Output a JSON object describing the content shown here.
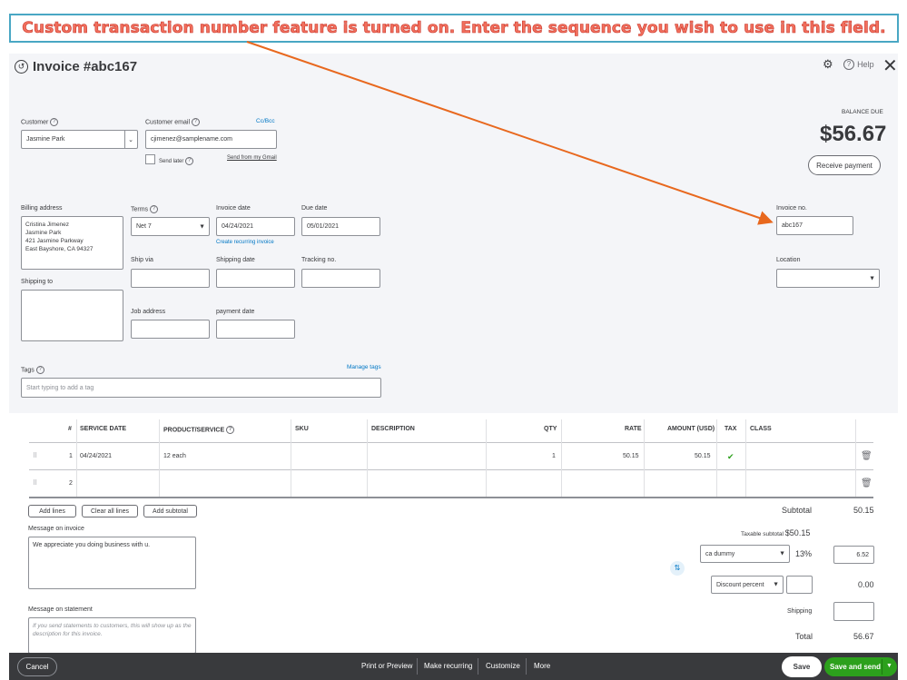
{
  "banner": {
    "text": "Custom transaction number feature is turned on. Enter the sequence you wish to use in this field."
  },
  "header": {
    "title": "Invoice #abc167",
    "help_label": "Help"
  },
  "customer": {
    "label": "Customer",
    "value": "Jasmine Park"
  },
  "customer_email": {
    "label": "Customer email",
    "value": "cjimenez@samplename.com",
    "cc_bcc": "Cc/Bcc",
    "send_later": "Send later",
    "send_gmail": "Send from my Gmail"
  },
  "balance": {
    "label": "BALANCE DUE",
    "amount": "$56.67",
    "receive_payment": "Receive payment"
  },
  "billing": {
    "label": "Billing address",
    "lines": [
      "Cristina Jimenez",
      "Jasmine Park",
      "421 Jasmine Parkway",
      "East Bayshore, CA  94327"
    ]
  },
  "shipping_to": {
    "label": "Shipping to"
  },
  "terms": {
    "label": "Terms",
    "value": "Net 7"
  },
  "invoice_date": {
    "label": "Invoice date",
    "value": "04/24/2021",
    "recurring_link": "Create recurring invoice"
  },
  "due_date": {
    "label": "Due date",
    "value": "05/01/2021"
  },
  "ship_via": {
    "label": "Ship via"
  },
  "shipping_date": {
    "label": "Shipping date"
  },
  "tracking_no": {
    "label": "Tracking no."
  },
  "job_address": {
    "label": "Job address"
  },
  "payment_date": {
    "label": "payment date"
  },
  "invoice_no": {
    "label": "Invoice no.",
    "value": "abc167"
  },
  "location": {
    "label": "Location"
  },
  "tags": {
    "label": "Tags",
    "manage": "Manage tags",
    "placeholder": "Start typing to add a tag"
  },
  "table": {
    "headers": [
      "#",
      "SERVICE DATE",
      "PRODUCT/SERVICE",
      "SKU",
      "DESCRIPTION",
      "QTY",
      "RATE",
      "AMOUNT (USD)",
      "TAX",
      "CLASS"
    ],
    "rows": [
      {
        "num": "1",
        "service_date": "04/24/2021",
        "product": "12 each",
        "qty": "1",
        "rate": "50.15",
        "amount": "50.15",
        "tax": "✔"
      },
      {
        "num": "2",
        "service_date": "",
        "product": "",
        "qty": "",
        "rate": "",
        "amount": "",
        "tax": ""
      }
    ]
  },
  "actions": {
    "add_lines": "Add lines",
    "clear_all": "Clear all lines",
    "add_subtotal": "Add subtotal"
  },
  "message_invoice": {
    "label": "Message on invoice",
    "value": "We appreciate you doing business with u."
  },
  "message_statement": {
    "label": "Message on statement",
    "placeholder": "If you send statements to customers, this will show up as the description for this invoice."
  },
  "totals": {
    "subtotal_label": "Subtotal",
    "subtotal": "50.15",
    "taxable_label": "Taxable subtotal",
    "taxable": "$50.15",
    "tax_name": "ca dummy",
    "tax_pct": "13%",
    "tax_amount": "6.52",
    "discount_type": "Discount percent",
    "discount_amount": "0.00",
    "shipping_label": "Shipping",
    "total_label": "Total",
    "total": "56.67"
  },
  "footer": {
    "cancel": "Cancel",
    "print": "Print or Preview",
    "recurring": "Make recurring",
    "customize": "Customize",
    "more": "More",
    "save": "Save",
    "save_send": "Save and send"
  },
  "colors": {
    "accent_green": "#2ca01c",
    "link_blue": "#0077c5",
    "arrow": "#e8681e",
    "banner_text": "#f2705e"
  }
}
